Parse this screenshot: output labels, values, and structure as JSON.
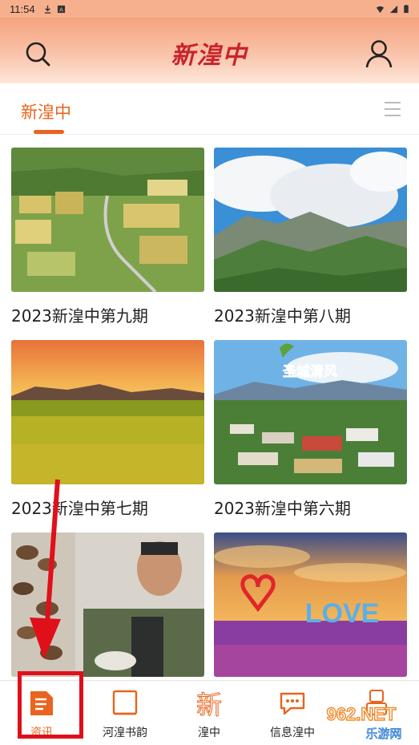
{
  "status_bar": {
    "time": "11:54",
    "left_icons": [
      "download-icon",
      "app-a-icon"
    ],
    "right_icons": [
      "wifi-icon",
      "signal-icon",
      "battery-icon"
    ]
  },
  "header": {
    "logo_text": "新湟中",
    "search_icon": "search-icon",
    "profile_icon": "user-icon"
  },
  "tabs": {
    "active_label": "新湟中",
    "menu_icon": "menu-icon"
  },
  "cards": [
    {
      "title": "2023新湟中第九期",
      "image": "aerial-farmland-village"
    },
    {
      "title": "2023新湟中第八期",
      "image": "mountain-clouds"
    },
    {
      "title": "2023新湟中第七期",
      "image": "sunset-rapeseed-field"
    },
    {
      "title": "2023新湟中第六期",
      "image": "town-aerial-圣城清风",
      "image_text": "圣城清风"
    },
    {
      "title": "",
      "image": "man-mushrooms"
    },
    {
      "title": "",
      "image": "love-flower-field",
      "image_text": "LOVE"
    }
  ],
  "bottom_nav": [
    {
      "label": "资讯",
      "icon": "news-icon",
      "active": true
    },
    {
      "label": "河湟书韵",
      "icon": "book-icon",
      "active": false
    },
    {
      "label": "湟中",
      "icon": "xin-character-icon",
      "active": false
    },
    {
      "label": "信息湟中",
      "icon": "chat-bubble-icon",
      "active": false
    },
    {
      "label": "",
      "icon": "robot-icon",
      "active": false
    }
  ],
  "watermark": {
    "text": "962.NET",
    "subtext": "乐游网"
  },
  "colors": {
    "accent": "#e8641f",
    "annotation": "#e0101a",
    "logo": "#c8242b"
  }
}
